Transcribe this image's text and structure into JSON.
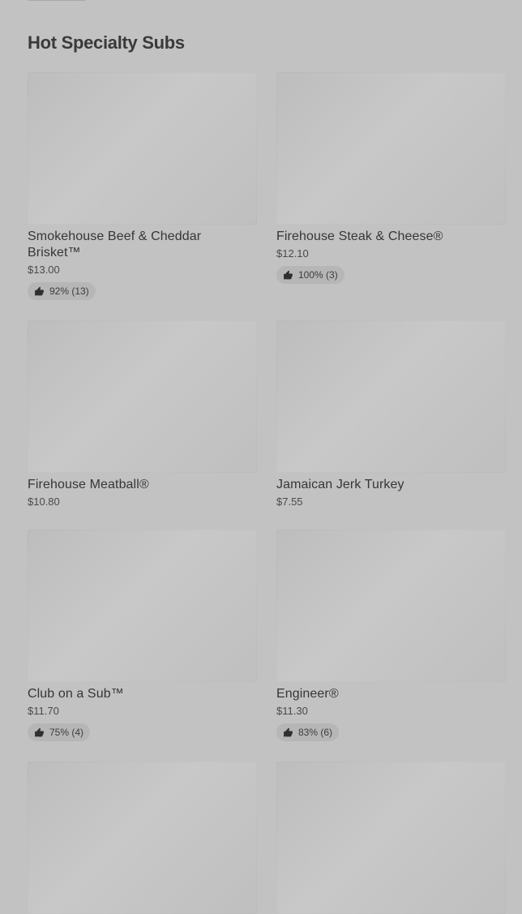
{
  "section": {
    "title": "Hot Specialty Subs"
  },
  "items": [
    {
      "name": "Smokehouse Beef & Cheddar Brisket™",
      "price": "$13.00",
      "rating": "92% (13)"
    },
    {
      "name": "Firehouse Steak & Cheese®",
      "price": "$12.10",
      "rating": "100% (3)"
    },
    {
      "name": "Firehouse Meatball®",
      "price": "$10.80"
    },
    {
      "name": "Jamaican Jerk Turkey",
      "price": "$7.55"
    },
    {
      "name": "Club on a Sub™",
      "price": "$11.70",
      "rating": "75% (4)"
    },
    {
      "name": "Engineer®",
      "price": "$11.30",
      "rating": "83% (6)"
    },
    {
      "name": ""
    },
    {
      "name": ""
    }
  ],
  "icons": {
    "rating": "thumbs-up-icon"
  },
  "colors": {
    "background": "#c2c2c2",
    "text": "#2f2f2f",
    "rating_pill": "#b6b6b6"
  }
}
